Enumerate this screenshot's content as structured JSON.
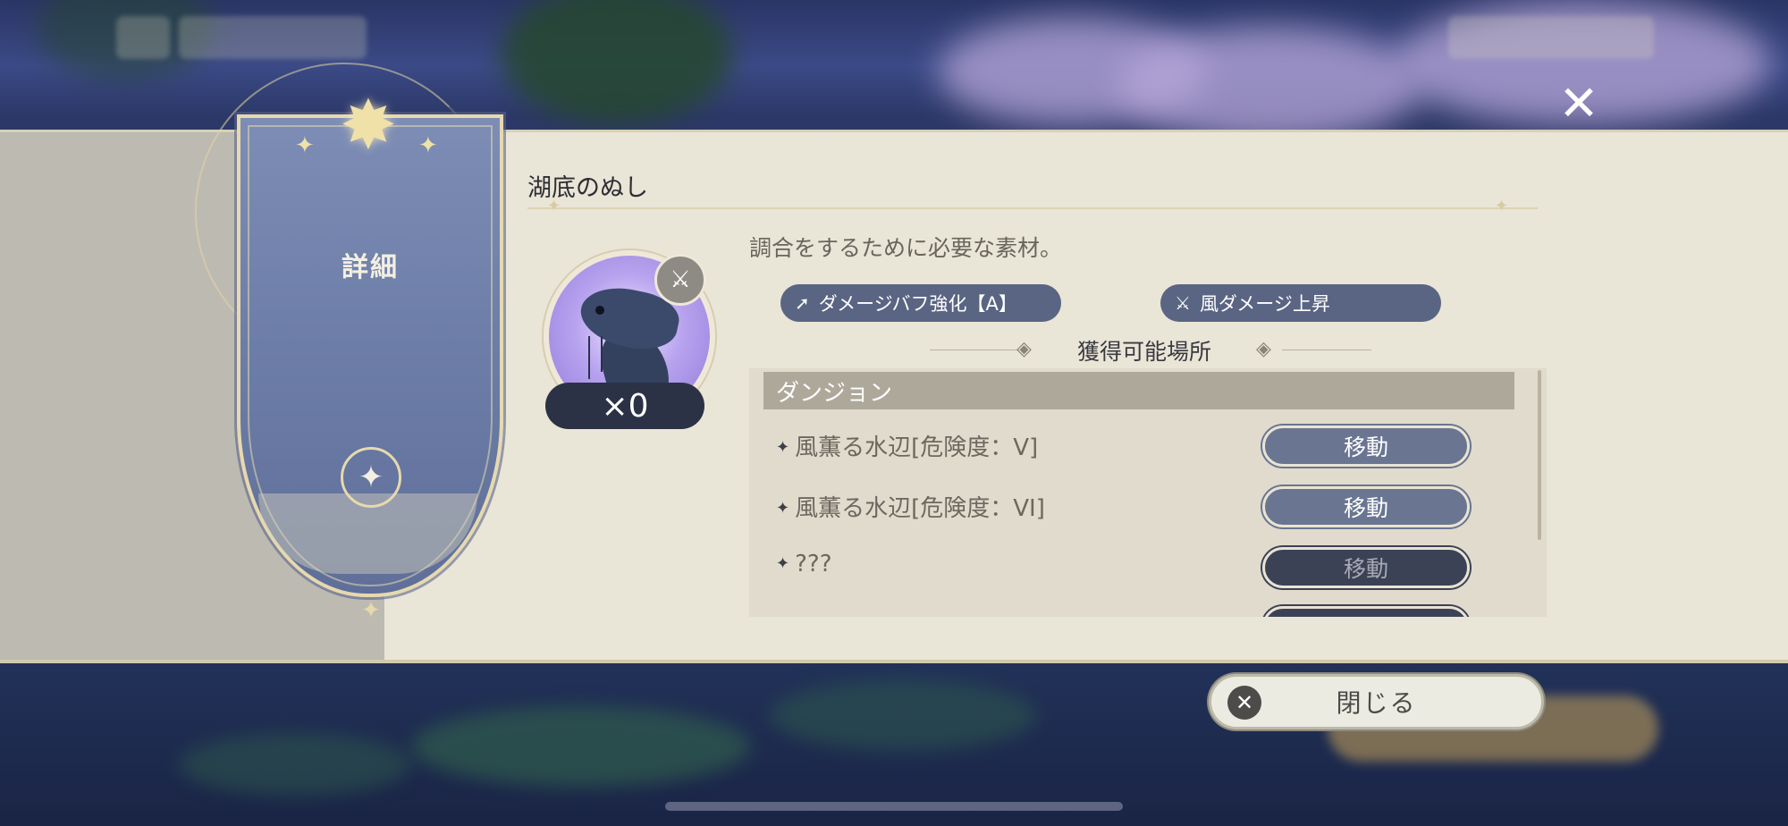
{
  "item": {
    "name": "湖底のぬし",
    "count": "×0",
    "description": "調合をするために必要な素材。"
  },
  "banner": {
    "title": "詳細"
  },
  "tags": [
    {
      "label": "ダメージバフ強化【A】",
      "icon": "sparkle-arrow-icon"
    },
    {
      "label": "風ダメージ上昇",
      "icon": "wind-sword-icon"
    }
  ],
  "locations": {
    "header": "獲得可能場所",
    "category": "ダンジョン",
    "rows": [
      {
        "label": "風薫る水辺[危険度：V]",
        "button": "移動",
        "enabled": true
      },
      {
        "label": "風薫る水辺[危険度：VI]",
        "button": "移動",
        "enabled": true
      },
      {
        "label": "???",
        "button": "移動",
        "enabled": false
      }
    ]
  },
  "footer": {
    "close_label": "閉じる"
  },
  "colors": {
    "panel": "#e9e5d7",
    "tag": "#5a6583",
    "move_active": "#6a7592",
    "move_inactive": "#3c4256",
    "accent_gold": "#e6d9ae"
  }
}
